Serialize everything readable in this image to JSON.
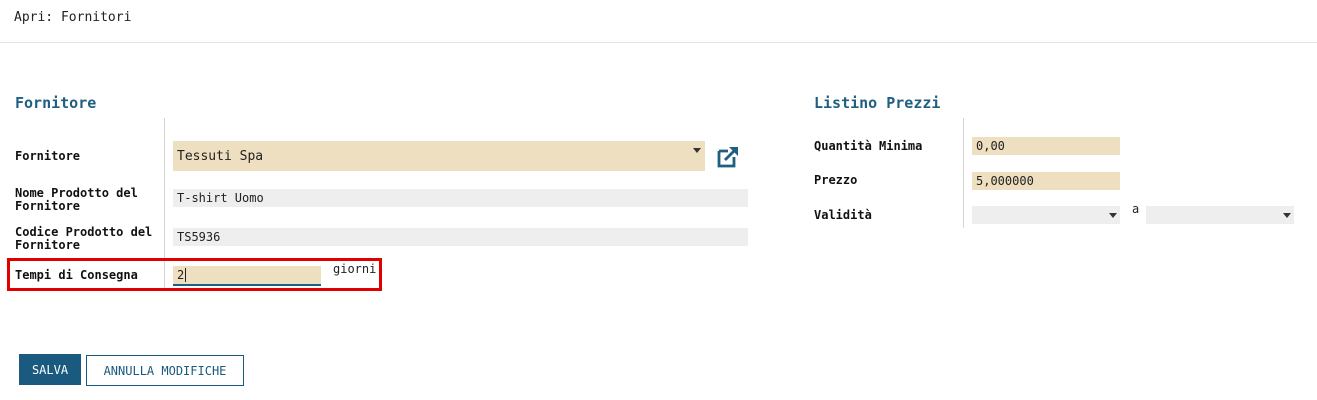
{
  "header": {
    "title": "Apri: Fornitori"
  },
  "supplier_section": {
    "title": "Fornitore",
    "fields": {
      "supplier": {
        "label": "Fornitore",
        "value": "Tessuti Spa"
      },
      "product_name": {
        "label": "Nome Prodotto del Fornitore",
        "value": "T-shirt Uomo"
      },
      "product_code": {
        "label": "Codice Prodotto del Fornitore",
        "value": "TS5936"
      },
      "lead_time": {
        "label": "Tempi di Consegna",
        "value": "2",
        "unit": "giorni"
      }
    }
  },
  "pricelist_section": {
    "title": "Listino Prezzi",
    "fields": {
      "min_qty": {
        "label": "Quantità Minima",
        "value": "0,00"
      },
      "price": {
        "label": "Prezzo",
        "value": "5,000000"
      },
      "validity": {
        "label": "Validità",
        "from_value": "",
        "separator": "a",
        "to_value": ""
      }
    }
  },
  "buttons": {
    "save": "SALVA",
    "discard": "ANNULLA MODIFICHE"
  },
  "icons": {
    "external_link": "external-link-icon",
    "dropdown": "caret-down-icon"
  },
  "colors": {
    "accent": "#1f5f82",
    "required_field": "#eddfbf",
    "optional_field": "#eeeeee",
    "highlight": "#e00000"
  }
}
